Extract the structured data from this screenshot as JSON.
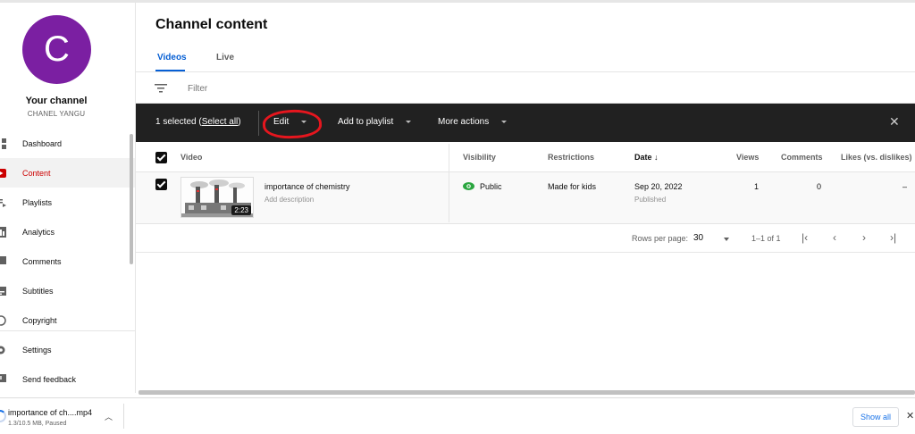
{
  "sidebar": {
    "avatar_letter": "C",
    "channel_title": "Your channel",
    "channel_name": "CHANEL YANGU",
    "items": [
      {
        "label": "Dashboard",
        "icon": "dashboard-icon"
      },
      {
        "label": "Content",
        "icon": "content-icon",
        "active": true
      },
      {
        "label": "Playlists",
        "icon": "playlists-icon"
      },
      {
        "label": "Analytics",
        "icon": "analytics-icon"
      },
      {
        "label": "Comments",
        "icon": "comments-icon"
      },
      {
        "label": "Subtitles",
        "icon": "subtitles-icon"
      },
      {
        "label": "Copyright",
        "icon": "copyright-icon"
      },
      {
        "label": "Settings",
        "icon": "gear-icon"
      },
      {
        "label": "Send feedback",
        "icon": "feedback-icon"
      }
    ]
  },
  "main": {
    "title": "Channel content",
    "tabs": [
      {
        "label": "Videos",
        "active": true
      },
      {
        "label": "Live"
      }
    ],
    "filter_placeholder": "Filter"
  },
  "actionbar": {
    "selected_text": "1 selected (",
    "select_all": "Select all",
    "close_paren": ")",
    "edit": "Edit",
    "add_to_playlist": "Add to playlist",
    "more_actions": "More actions"
  },
  "table": {
    "headers": {
      "video": "Video",
      "visibility": "Visibility",
      "restrictions": "Restrictions",
      "date": "Date",
      "date_sort": "↓",
      "views": "Views",
      "comments": "Comments",
      "likes": "Likes (vs. dislikes)"
    },
    "rows": [
      {
        "title": "importance of chemistry",
        "description": "Add description",
        "duration": "2:23",
        "visibility": "Public",
        "restrictions": "Made for kids",
        "date": "Sep 20, 2022",
        "status": "Published",
        "views": "1",
        "comments": "0",
        "likes": "–"
      }
    ]
  },
  "pagination": {
    "rows_label": "Rows per page:",
    "rows_value": "30",
    "range": "1–1 of 1"
  },
  "download": {
    "filename": "importance of ch....mp4",
    "status": "1.3/10.5 MB, Paused",
    "show_all": "Show all"
  },
  "colors": {
    "accent_blue": "#065fd4",
    "active_red": "#cc0000",
    "avatar_purple": "#7b1fa2",
    "actionbar_bg": "#212121",
    "public_green": "#2ba640",
    "annotation_red": "#e5161e"
  }
}
